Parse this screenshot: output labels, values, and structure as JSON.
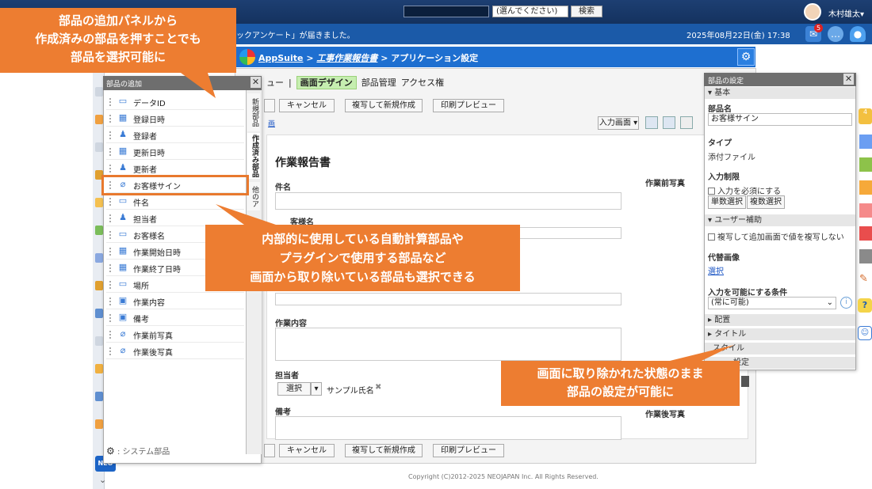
{
  "topbar": {
    "scope_select": "(選んでください)",
    "search_button": "検索",
    "user_name": "木村雄太▾"
  },
  "infobar": {
    "notice": "ックアンケート」が届きました。",
    "datetime": "2025年08月22日(金) 17:38",
    "badge_count": "5"
  },
  "header": {
    "app_name": "AppSuite",
    "sep1": " > ",
    "item": "工事作業報告書",
    "sep2": " > ",
    "page": "アプリケーション設定"
  },
  "editor": {
    "menu": [
      "ュー",
      "|",
      "画面デザイン",
      "部品管理",
      "アクセス権"
    ],
    "toolbar": {
      "cancel": "キャンセル",
      "copy_new": "複写して新規作成",
      "print_preview": "印刷プレビュー",
      "screen_select": "入力画面 ▾",
      "link_fragment": "画"
    },
    "form": {
      "title": "作業報告書",
      "field_name": "件名",
      "field_customer": "客様名",
      "field_content": "作業内容",
      "field_assignee": "担当者",
      "assignee_select": "選択",
      "assignee_value": "サンプル氏名",
      "field_notes": "備考",
      "before_photo": "作業前写真",
      "after_photo": "作業後写真"
    }
  },
  "add_panel": {
    "title": "部品の追加",
    "tabs": [
      "新規部品",
      "作成済み部品",
      "他のア"
    ],
    "items": [
      {
        "label": "データID",
        "icon": "id-icon"
      },
      {
        "label": "登録日時",
        "icon": "calendar-gear-icon"
      },
      {
        "label": "登録者",
        "icon": "user-gear-icon"
      },
      {
        "label": "更新日時",
        "icon": "calendar-gear-icon"
      },
      {
        "label": "更新者",
        "icon": "user-gear-icon"
      },
      {
        "label": "お客様サイン",
        "icon": "paperclip-icon"
      },
      {
        "label": "件名",
        "icon": "textbox-icon"
      },
      {
        "label": "担当者",
        "icon": "user-check-icon"
      },
      {
        "label": "お客様名",
        "icon": "textbox-icon"
      },
      {
        "label": "作業開始日時",
        "icon": "calendar-icon"
      },
      {
        "label": "作業終了日時",
        "icon": "calendar-icon"
      },
      {
        "label": "場所",
        "icon": "textbox-icon"
      },
      {
        "label": "作業内容",
        "icon": "textarea-icon"
      },
      {
        "label": "備考",
        "icon": "textarea-icon"
      },
      {
        "label": "作業前写真",
        "icon": "paperclip-icon"
      },
      {
        "label": "作業後写真",
        "icon": "paperclip-icon"
      }
    ],
    "system_parts": ": システム部品"
  },
  "settings_panel": {
    "title": "部品の設定",
    "section_basic": "▾ 基本",
    "name_label": "部品名",
    "name_value": "お客様サイン",
    "type_label": "タイプ",
    "type_value": "添付ファイル",
    "input_limit_label": "入力制限",
    "required_label": "入力を必須にする",
    "single_select": "単数選択",
    "multi_select": "複数選択",
    "section_assist": "▾ ユーザー補助",
    "no_copy_label": "複写して追加画面で値を複写しない",
    "alt_image_label": "代替画像",
    "alt_image_link": "選択",
    "condition_label": "入力を可能にする条件",
    "condition_value": "(常に可能)",
    "section_layout": "▸ 配置",
    "section_title": "▸ タイトル",
    "section_style": "スタイル",
    "section_detail": "設定"
  },
  "callouts": {
    "top_left": [
      "部品の追加パネルから",
      "作成済みの部品を押すことでも",
      "部品を選択可能に"
    ],
    "middle": [
      "内部的に使用している自動計算部品や",
      "プラグインで使用する部品など",
      "画面から取り除いている部品も選択できる"
    ],
    "bottom_right": [
      "画面に取り除かれた状態のまま",
      "部品の設定が可能に"
    ]
  },
  "footer": {
    "copyright": "Copyright (C)2012-2025 NEOJAPAN Inc. All Rights Reserved."
  },
  "colors": {
    "accent_orange": "#ed7d31",
    "header_blue": "#1e6fd0",
    "design_tab_green": "#c6eeb0"
  }
}
